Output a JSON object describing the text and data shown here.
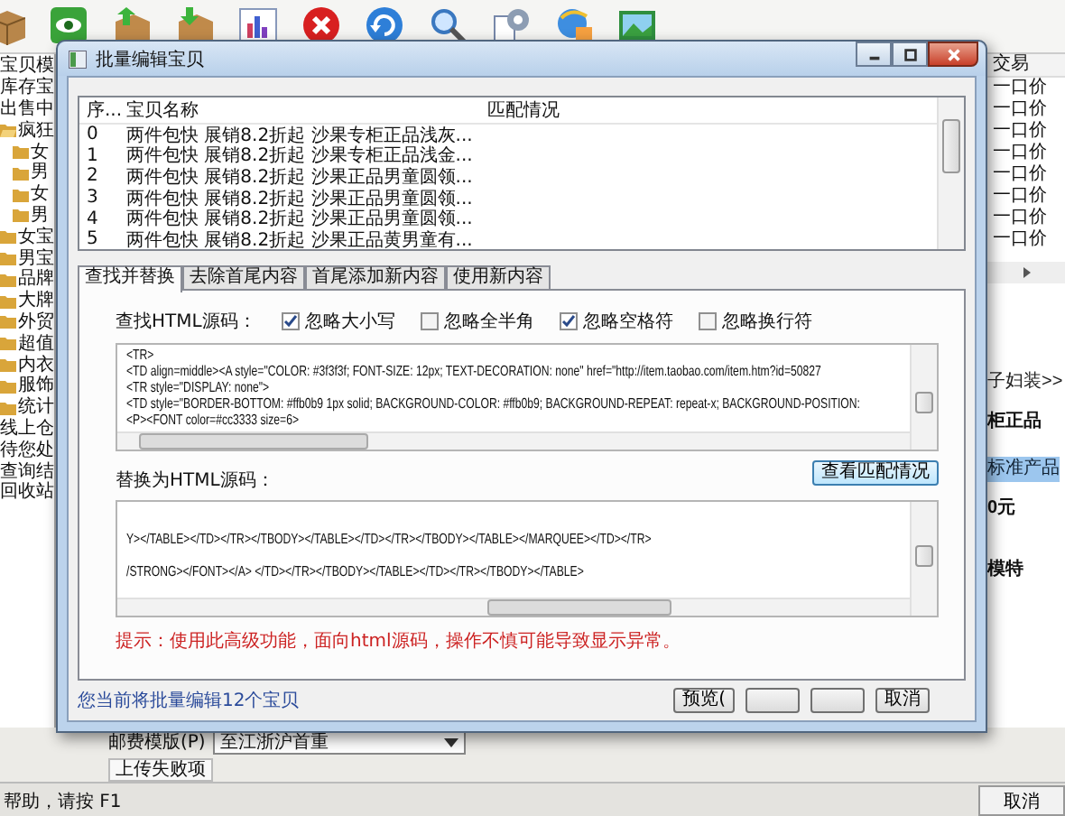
{
  "nav_tree": [
    {
      "label": "宝贝模",
      "kind": "plain"
    },
    {
      "label": "库存宝",
      "kind": "plain"
    },
    {
      "label": "出售中",
      "kind": "plain"
    },
    {
      "label": "疯狂",
      "kind": "folder",
      "expanded": true,
      "children": [
        {
          "label": "女",
          "kind": "folder"
        },
        {
          "label": "男",
          "kind": "folder"
        },
        {
          "label": "女",
          "kind": "folder"
        },
        {
          "label": "男",
          "kind": "folder"
        }
      ]
    },
    {
      "label": "女宝",
      "kind": "folder"
    },
    {
      "label": "男宝",
      "kind": "folder"
    },
    {
      "label": "品牌",
      "kind": "folder"
    },
    {
      "label": "大牌",
      "kind": "folder"
    },
    {
      "label": "外贸",
      "kind": "folder"
    },
    {
      "label": "超值",
      "kind": "folder"
    },
    {
      "label": "内衣",
      "kind": "folder"
    },
    {
      "label": "服饰",
      "kind": "folder"
    },
    {
      "label": "统计",
      "kind": "folder"
    },
    {
      "label": "线上仓",
      "kind": "plain"
    },
    {
      "label": "待您处",
      "kind": "plain"
    },
    {
      "label": "查询结",
      "kind": "plain"
    },
    {
      "label": "回收站",
      "kind": "plain"
    }
  ],
  "right_column": {
    "header": "交易",
    "rows": [
      "一口价",
      "一口价",
      "一口价",
      "一口价",
      "一口价",
      "一口价",
      "一口价",
      "一口价"
    ]
  },
  "right_form": [
    {
      "text": "子妇装>>",
      "kind": "link"
    },
    {
      "text": "柜正品",
      "kind": "bold"
    },
    {
      "text": "标准产品",
      "kind": "highlight"
    },
    {
      "text": "0元",
      "kind": "bold"
    },
    {
      "text": "模特",
      "kind": "bold"
    }
  ],
  "upload_form": {
    "postage_label": "邮费模版(P)",
    "postage_value": "至江浙沪首重",
    "failed_tab": "上传失败项"
  },
  "status_bar": {
    "text": "帮助，请按 F1",
    "cancel_button": "取消"
  },
  "dialog": {
    "title": "批量编辑宝贝",
    "list": {
      "columns": [
        "序...",
        "宝贝名称",
        "匹配情况"
      ],
      "rows": [
        {
          "index": "0",
          "name": "两件包快 展销8.2折起 沙果专柜正品浅灰..."
        },
        {
          "index": "1",
          "name": "两件包快 展销8.2折起 沙果专柜正品浅金..."
        },
        {
          "index": "2",
          "name": "两件包快 展销8.2折起 沙果正品男童圆领..."
        },
        {
          "index": "3",
          "name": "两件包快 展销8.2折起 沙果正品男童圆领..."
        },
        {
          "index": "4",
          "name": "两件包快 展销8.2折起 沙果正品男童圆领..."
        },
        {
          "index": "5",
          "name": "两件包快 展销8.2折起 沙果正品黄男童有..."
        }
      ]
    },
    "tabs": [
      {
        "label": "查找并替换",
        "selected": true
      },
      {
        "label": "去除首尾内容",
        "selected": false
      },
      {
        "label": "首尾添加新内容",
        "selected": false
      },
      {
        "label": "使用新内容",
        "selected": false
      }
    ],
    "find": {
      "label": "查找HTML源码：",
      "options": [
        {
          "label": "忽略大小写",
          "checked": true
        },
        {
          "label": "忽略全半角",
          "checked": false
        },
        {
          "label": "忽略空格符",
          "checked": true
        },
        {
          "label": "忽略换行符",
          "checked": false
        }
      ],
      "lines": [
        "<TR>",
        "<TD align=middle><A style=\"COLOR: #3f3f3f; FONT-SIZE: 12px; TEXT-DECORATION: none\" href=\"http://item.taobao.com/item.htm?id=50827",
        "<TR style=\"DISPLAY: none\">",
        "<TD style=\"BORDER-BOTTOM: #ffb0b9 1px solid; BACKGROUND-COLOR: #ffb0b9; BACKGROUND-REPEAT: repeat-x; BACKGROUND-POSITION:",
        "<P><FONT color=#cc3333 size=6>"
      ]
    },
    "match_button": "查看匹配情况",
    "replace": {
      "label": "替换为HTML源码：",
      "lines": [
        "Y></TABLE></TD></TR></TBODY></TABLE></TD></TR></TBODY></TABLE></MARQUEE></TD></TR>",
        "/STRONG></FONT></A> </TD></TR></TBODY></TABLE></TD></TR></TBODY></TABLE>"
      ]
    },
    "hint": "提示：使用此高级功能，面向html源码，操作不慎可能导致显示异常。",
    "footer": "您当前将批量编辑12个宝贝",
    "buttons": [
      {
        "kind": "text",
        "label": "预览("
      },
      {
        "kind": "blank"
      },
      {
        "kind": "blank"
      },
      {
        "kind": "text",
        "label": "取消"
      }
    ]
  }
}
